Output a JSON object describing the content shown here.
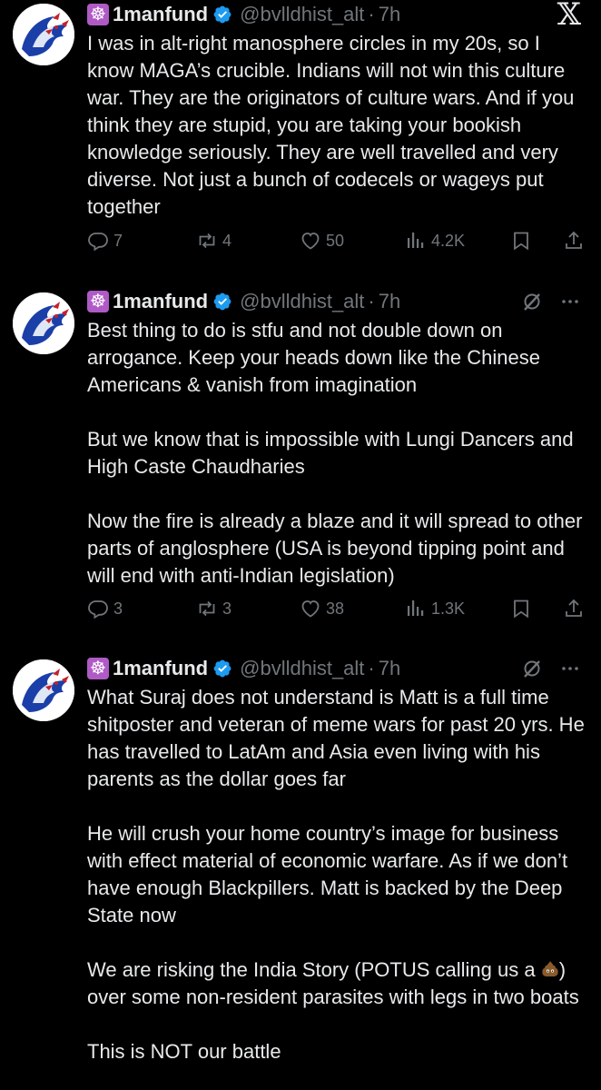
{
  "colors": {
    "background": "#000000",
    "text": "#e7e9ea",
    "muted": "#71767b",
    "verified": "#1d9bf0",
    "wheel_badge": "#b05ac6"
  },
  "x_logo": "𝕏",
  "tweets": [
    {
      "author": {
        "badge_icon": "wheel-of-dharma-emoji",
        "badge": "☸",
        "display_name": "1manfund",
        "handle": "@bvlldhist_alt",
        "separator": "·",
        "time": "7h"
      },
      "paragraphs": [
        "I was in alt-right manosphere circles in my 20s, so I know MAGA’s crucible. Indians will not win this culture war. They are the originators of culture wars. And if you think they are stupid, you are taking your bookish knowledge seriously. They are well travelled and very diverse. Not just a bunch of codecels or wageys put together"
      ],
      "replies": "7",
      "reposts": "4",
      "likes": "50",
      "views": "4.2K"
    },
    {
      "author": {
        "badge_icon": "wheel-of-dharma-emoji",
        "badge": "☸",
        "display_name": "1manfund",
        "handle": "@bvlldhist_alt",
        "separator": "·",
        "time": "7h"
      },
      "paragraphs": [
        "Best thing to do is stfu and not double down on arrogance. Keep your heads down like the Chinese Americans & vanish from imagination",
        "But we know that is impossible with Lungi Dancers and High Caste Chaudharies",
        "Now the fire is already a blaze and it will spread to other parts of anglosphere (USA is beyond tipping point and will end with anti-Indian legislation)"
      ],
      "replies": "3",
      "reposts": "3",
      "likes": "38",
      "views": "1.3K"
    },
    {
      "author": {
        "badge_icon": "wheel-of-dharma-emoji",
        "badge": "☸",
        "display_name": "1manfund",
        "handle": "@bvlldhist_alt",
        "separator": "·",
        "time": "7h"
      },
      "paragraphs": [
        "What Suraj does not understand is Matt is a full time shitposter and veteran of meme wars for past 20 yrs. He has travelled to LatAm and Asia even living with his parents as the dollar goes far",
        "He will crush your home country’s image for business with effect material of economic warfare. As if we don’t have enough Blackpillers. Matt is backed by the Deep State now"
      ],
      "p3_before_emoji": "We are risking the India Story (POTUS calling us a ",
      "p3_emoji_icon": "pile-of-poo-emoji",
      "p3_after_emoji": ") over some non-resident parasites with legs in two boats",
      "p4": "This is NOT our battle"
    }
  ]
}
